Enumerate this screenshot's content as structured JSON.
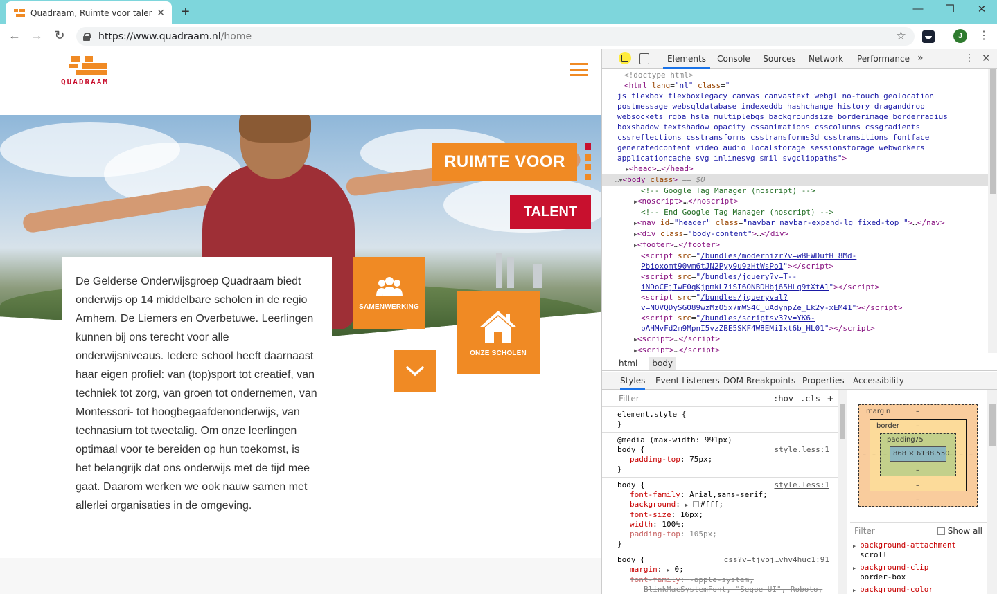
{
  "browser": {
    "tab_title": "Quadraam, Ruimte voor talent | D",
    "url_host": "https://www.quadraam.nl",
    "url_path": "/home",
    "avatar_letter": "J"
  },
  "site": {
    "logo_text": "QUADRAAM",
    "hero_line1": "RUIMTE VOOR",
    "hero_line2": "TALENT",
    "intro_text": "De Gelderse Onderwijsgroep Quadraam biedt onderwijs op 14 middelbare scholen in de regio Arnhem, De Liemers en Overbetuwe. Leerlingen kunnen bij ons terecht voor alle onderwijsniveaus. Iedere school heeft daarnaast haar eigen profiel: van (top)sport tot creatief, van techniek tot zorg, van groen tot ondernemen, van Montessori- tot hoogbegaafdenonderwijs, van technasium tot tweetalig. Om onze leerlingen optimaal voor te bereiden op hun toekomst, is het belangrijk dat ons onderwijs met de tijd mee gaat. Daarom werken we ook nauw samen met allerlei organisaties in de omgeving.",
    "tile_samenwerking": "SAMENWERKING",
    "tile_scholen": "ONZE SCHOLEN",
    "accent_orange": "#f08a24",
    "accent_red": "#c8102e"
  },
  "devtools": {
    "tabs": [
      "Elements",
      "Console",
      "Sources",
      "Network",
      "Performance"
    ],
    "more": "»",
    "breadcrumbs": [
      "html",
      "body"
    ],
    "sub_tabs": [
      "Styles",
      "Event Listeners",
      "DOM Breakpoints",
      "Properties",
      "Accessibility"
    ],
    "styles_filter": "Filter",
    "hov": ":hov",
    "cls": ".cls",
    "plus": "+",
    "dom": {
      "doctype": "<!doctype html>",
      "html_class": "js flexbox flexboxlegacy canvas canvastext webgl no-touch geolocation postmessage websqldatabase indexeddb hashchange history draganddrop websockets rgba hsla multiplebgs backgroundsize borderimage borderradius boxshadow textshadow opacity cssanimations csscolumns cssgradients cssreflections csstransforms csstransforms3d csstransitions fontface generatedcontent video audio localstorage sessionstorage webworkers applicationcache svg inlinesvg smil svgclippaths",
      "html_lang": "nl",
      "selected_suffix": "== $0",
      "comment_gtm": "<!-- Google Tag Manager (noscript) -->",
      "comment_gtm_end": "<!-- End Google Tag Manager (noscript) -->",
      "nav_id": "header",
      "nav_class": "navbar navbar-expand-lg fixed-top ",
      "div_class": "body-content",
      "script1": "/bundles/modernizr?v=wBEWDufH_8Md-Pbioxomt90vm6tJN2Pyy9u9zHtWsPo1",
      "script2": "/bundles/jquery?v=T--iNDoCEjIwE0qKjpmkL7iSI6ONBDHbj65HLq9tXtA1",
      "script3": "/bundles/jqueryval?v=NOVQDySGO89wzMzO5x7mWS4C_uAdynpZe_Lk2y-xEM41",
      "script4": "/bundles/scriptsv3?v=YK6-pAHMvFd2m9MpnI5vzZBE5SKF4W8EMiIxt6b_HL01"
    },
    "rules": {
      "element_style": "element.style {",
      "media": "@media (max-width: 991px)",
      "src1": "style.less:1",
      "src2": "style.less:1",
      "src3": "css?v=tjvoj…vhv4huc1:91",
      "padding_top": "75px;",
      "font_family": "Arial,sans-serif;",
      "background": "#fff;",
      "font_size": "16px;",
      "width": "100%;",
      "padding_top_struck": "105px;",
      "margin": "0;",
      "font_family_struck": "-apple-system,",
      "font_family_struck2": "BlinkMacSystemFont, \"Segoe UI\", Roboto,"
    },
    "box_model": {
      "margin_label": "margin",
      "border_label": "border",
      "padding_label": "padding",
      "padding_value": "75",
      "content": "868 × 6138.550",
      "dash": "–"
    },
    "computed": {
      "filter": "Filter",
      "show_all": "Show all",
      "props": [
        {
          "name": "background-attachment",
          "value": "scroll"
        },
        {
          "name": "background-clip",
          "value": "border-box"
        },
        {
          "name": "background-color",
          "value": ""
        }
      ]
    }
  }
}
